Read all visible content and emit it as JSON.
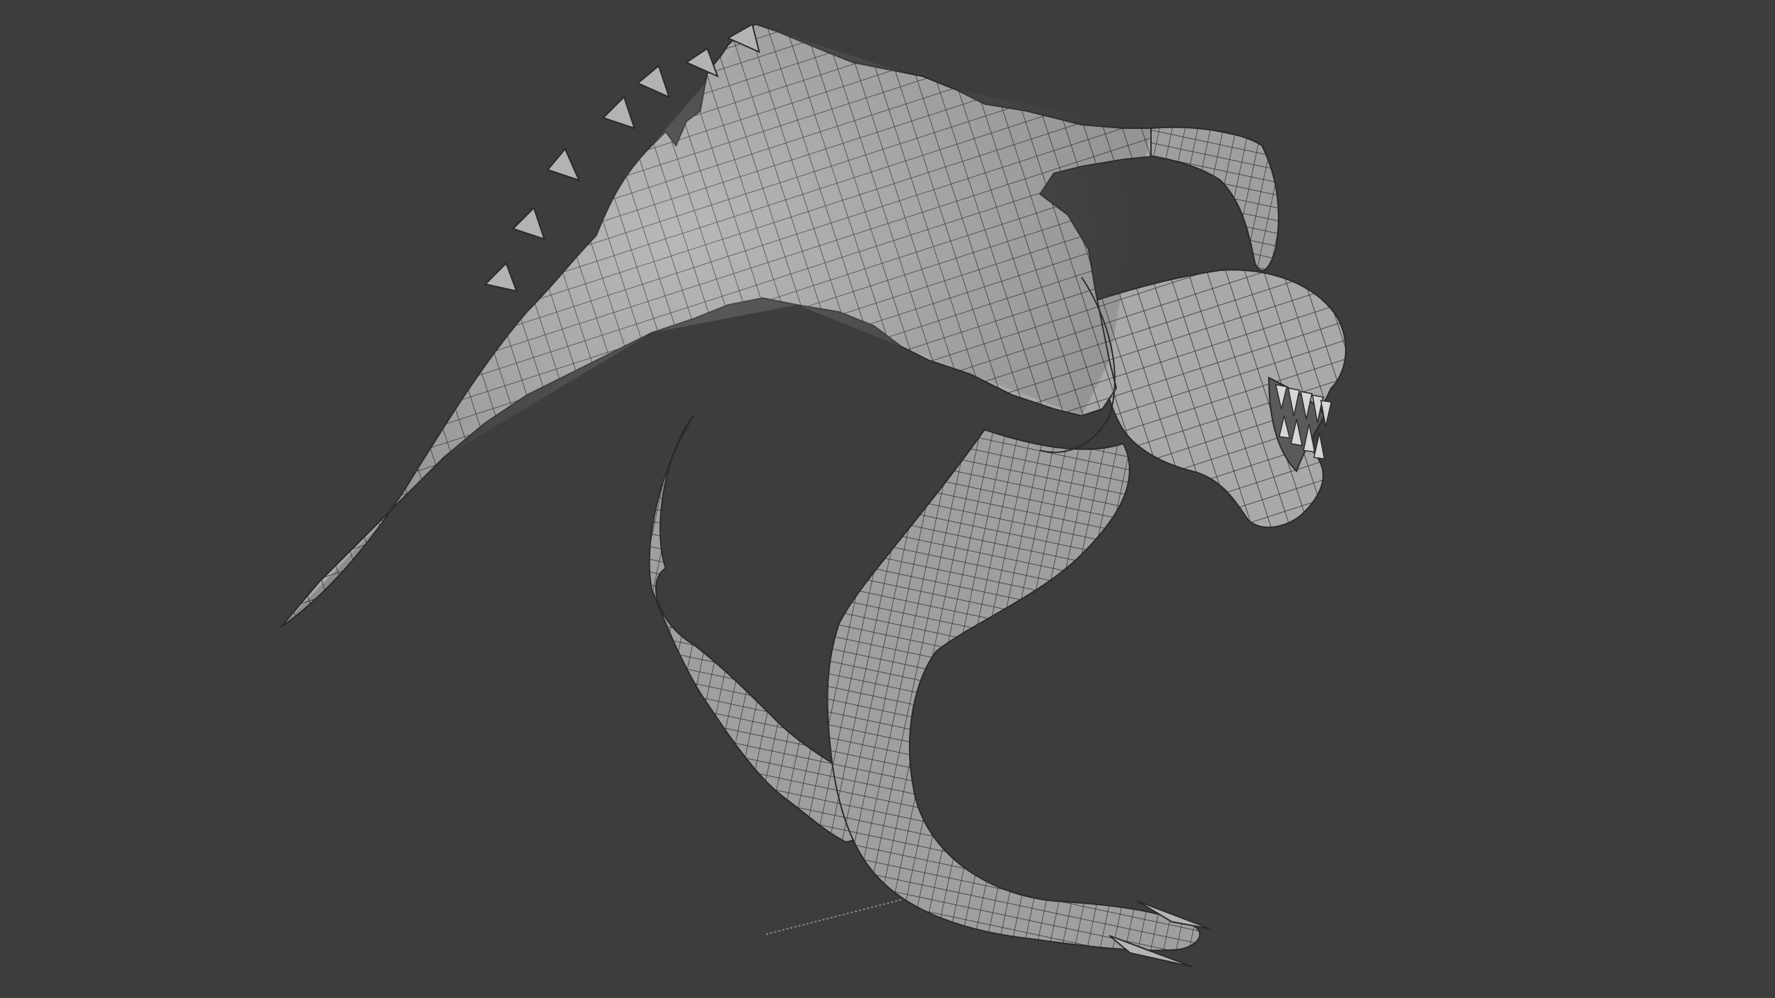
{
  "viewport": {
    "background_color": "#3d3d3d",
    "mesh_fill_color": "#a6a6a6",
    "mesh_wire_color": "#2a2a2a",
    "mesh_highlight_color": "#c4c4c4",
    "ground_line_color": "#8a8a8a"
  },
  "model": {
    "icon": "creature-mesh-icon"
  }
}
